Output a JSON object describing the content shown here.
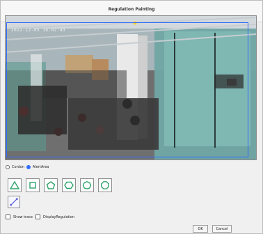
{
  "window": {
    "title": "Regulation Painting"
  },
  "video": {
    "timestamp": "2022-12-05 16:02:43"
  },
  "mode": {
    "options": [
      "Cordon",
      "AlertArea"
    ],
    "selected": "AlertArea"
  },
  "shapes": [
    "triangle-icon",
    "square-icon",
    "pentagon-icon",
    "hexagon-icon",
    "heptagon-icon",
    "octagon-icon"
  ],
  "tools": {
    "custom_label": ""
  },
  "checks": {
    "show_trace": "Show trace",
    "display_regulation": "DisplayRegulation"
  },
  "buttons": {
    "ok": "OK",
    "cancel": "Cancel"
  },
  "colors": {
    "selection": "#2f6bff",
    "shape_green": "#2ea36b"
  }
}
